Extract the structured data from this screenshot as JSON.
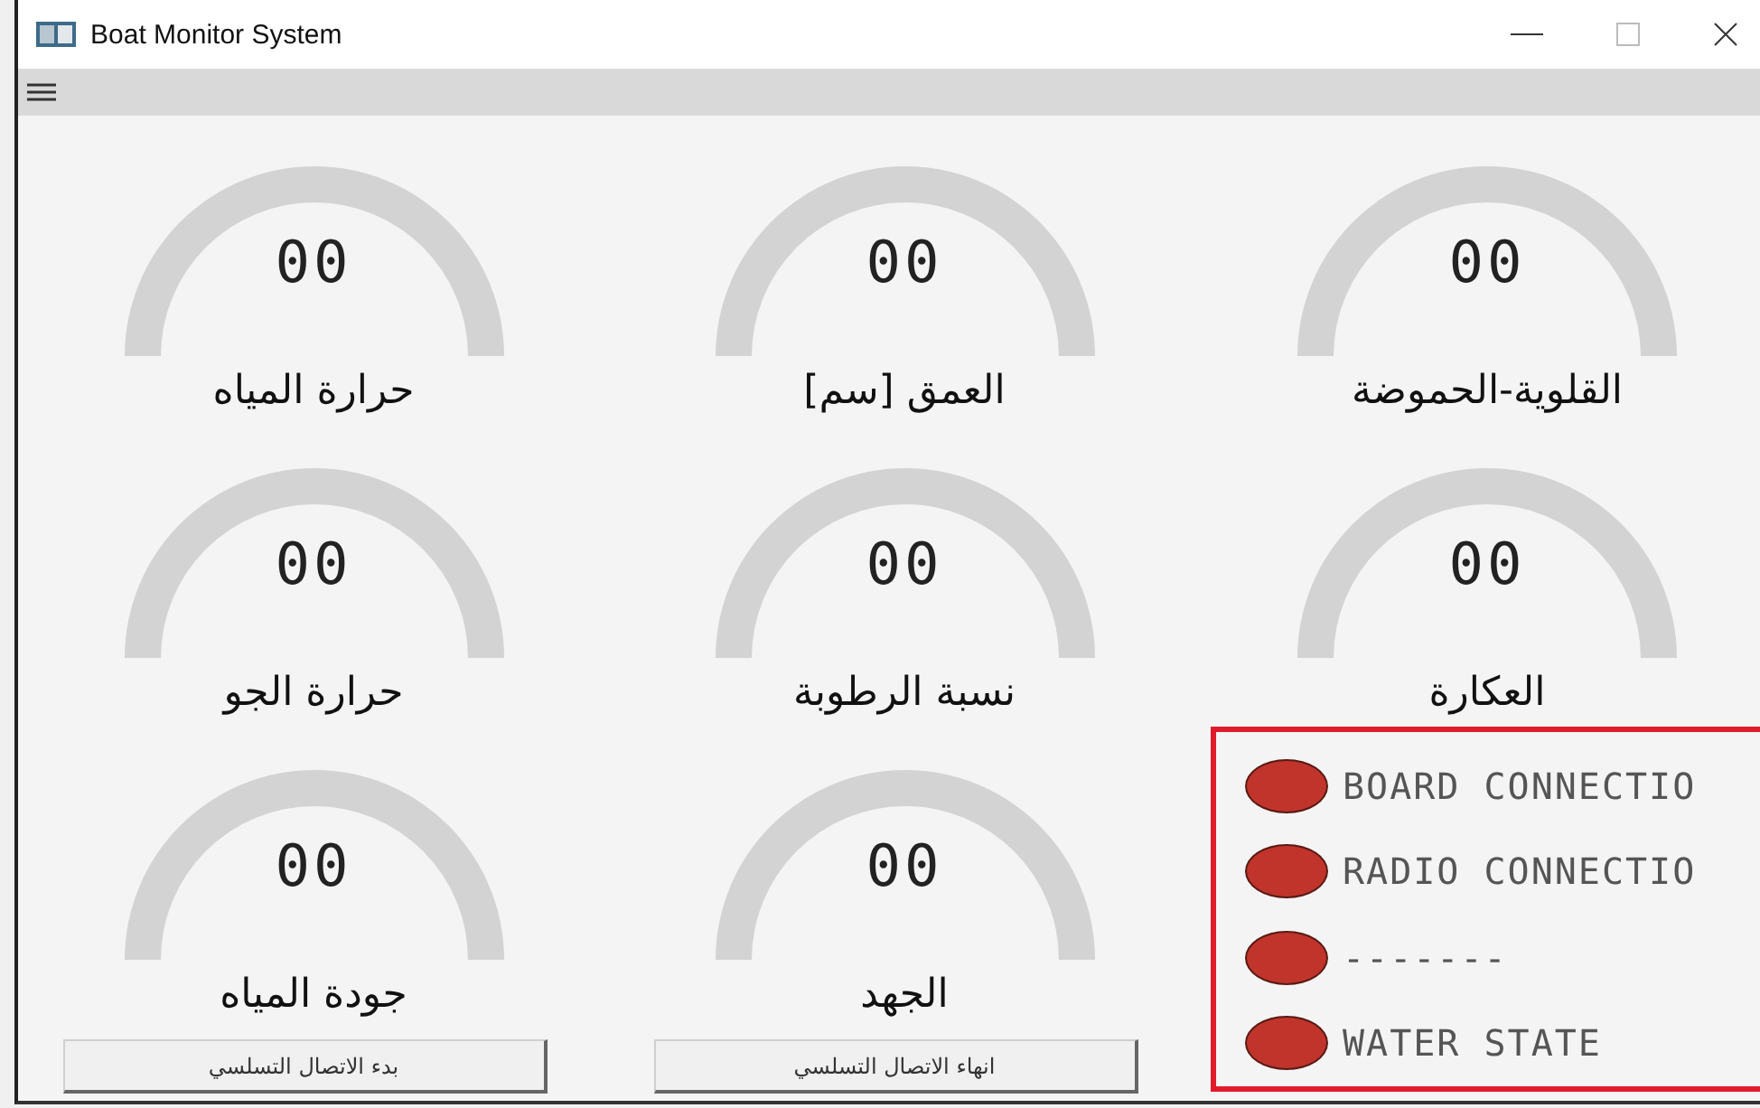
{
  "window": {
    "title": "Boat Monitor System"
  },
  "gauges": [
    {
      "value": "00",
      "label": "القلوية-الحموضة"
    },
    {
      "value": "00",
      "label": "العمق [سم]"
    },
    {
      "value": "00",
      "label": "حرارة المياه"
    },
    {
      "value": "00",
      "label": "العكارة"
    },
    {
      "value": "00",
      "label": "نسبة الرطوبة"
    },
    {
      "value": "00",
      "label": "حرارة الجو"
    },
    {
      "value": "00",
      "label": "الجهد"
    },
    {
      "value": "00",
      "label": "جودة المياه"
    }
  ],
  "buttons": [
    "انهاء الاتصال التسلسي",
    "بدء الاتصال التسلسي"
  ],
  "status": [
    {
      "label": "BOARD CONNECTIO",
      "color": "#c0342c"
    },
    {
      "label": "RADIO CONNECTIO",
      "color": "#c0342c"
    },
    {
      "label": "-------",
      "color": "#c0342c"
    },
    {
      "label": "WATER STATE",
      "color": "#c0342c"
    }
  ]
}
